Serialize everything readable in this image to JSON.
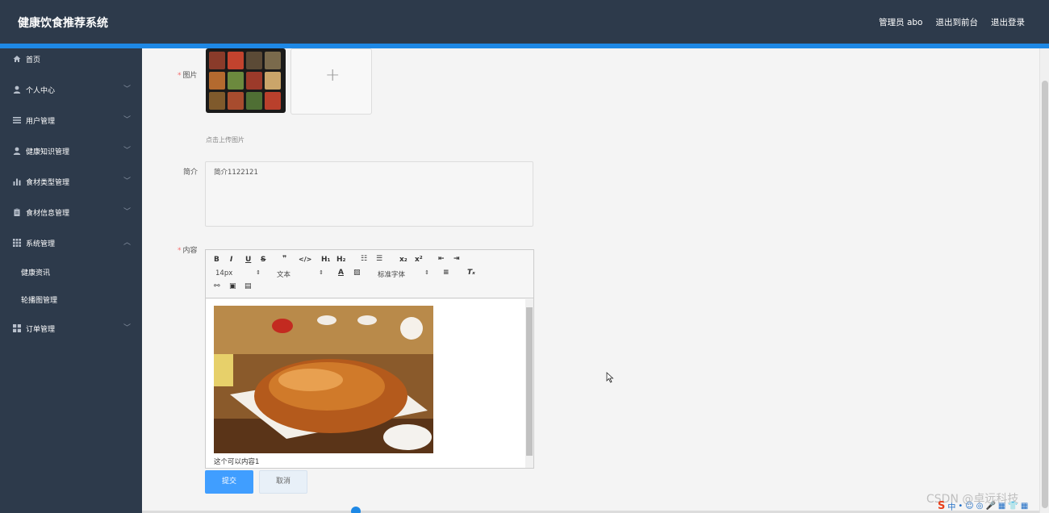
{
  "header": {
    "app_title": "健康饮食推荐系统",
    "admin_label": "管理员 abo",
    "back_to_front": "退出到前台",
    "logout": "退出登录"
  },
  "sidebar": {
    "items": [
      {
        "label": "首页",
        "icon": "home-icon"
      },
      {
        "label": "个人中心",
        "icon": "user-icon"
      },
      {
        "label": "用户管理",
        "icon": "list-icon"
      },
      {
        "label": "健康知识管理",
        "icon": "user-icon"
      },
      {
        "label": "食材类型管理",
        "icon": "bar-chart-icon"
      },
      {
        "label": "食材信息管理",
        "icon": "clipboard-icon"
      },
      {
        "label": "系统管理",
        "icon": "grid-icon"
      },
      {
        "label": "订单管理",
        "icon": "grid-icon"
      }
    ],
    "subitems": [
      {
        "label": "健康资讯"
      },
      {
        "label": "轮播图管理"
      }
    ]
  },
  "form": {
    "image_label": "图片",
    "upload_hint": "点击上传图片",
    "intro_label": "简介",
    "intro_value": "简介1122121",
    "content_label": "内容",
    "editor": {
      "font_size": "14px",
      "text_type": "文本",
      "font_family": "标准字体",
      "content_text": "这个可以内容1"
    },
    "submit_label": "提交",
    "cancel_label": "取消"
  },
  "overlay": {
    "watermark": "CSDN @卓远科技",
    "tray_items": [
      "S",
      "中",
      "•",
      "☺",
      "◎",
      "🎤",
      "▦",
      "👕",
      "▦"
    ]
  },
  "colors": {
    "header_bg": "#2d3a4b",
    "accent_blue": "#1e88e5",
    "primary_button": "#409eff",
    "required_star": "#f56c6c"
  }
}
